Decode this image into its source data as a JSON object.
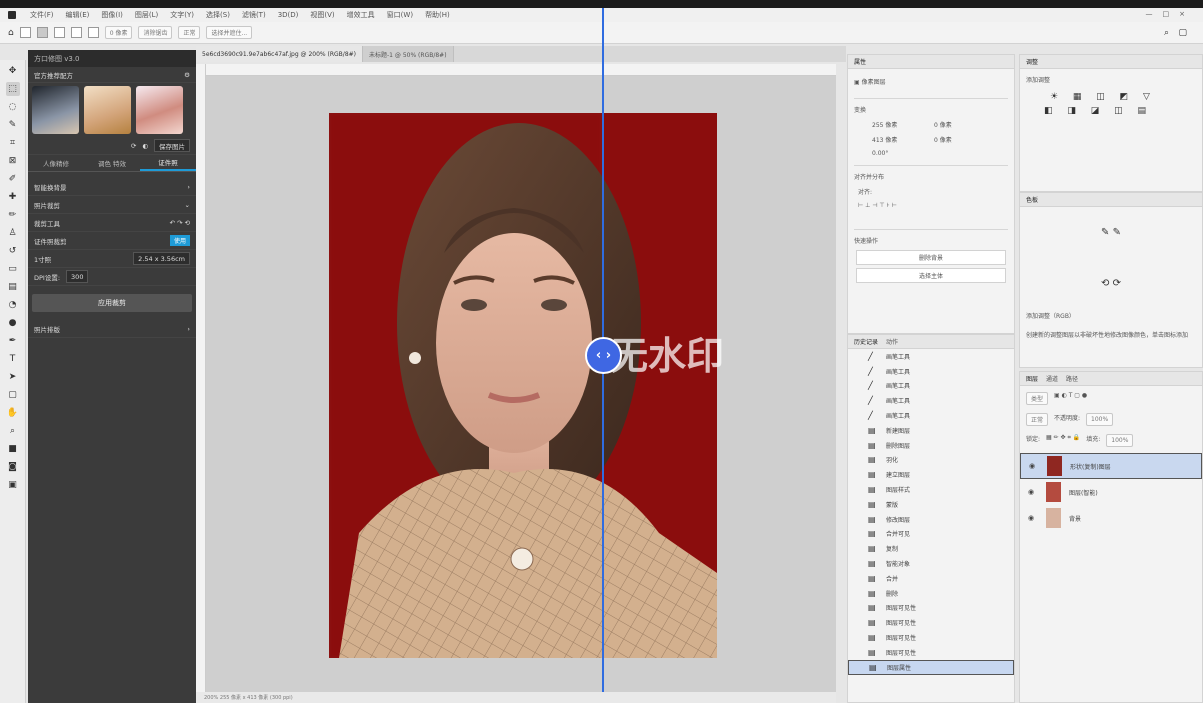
{
  "menubar": {
    "items": [
      "文件(F)",
      "编辑(E)",
      "图像(I)",
      "图层(L)",
      "文字(Y)",
      "选择(S)",
      "滤镜(T)",
      "3D(D)",
      "视图(V)",
      "增效工具",
      "窗口(W)",
      "帮助(H)"
    ],
    "window_controls": [
      "—",
      "□",
      "×"
    ]
  },
  "options": {
    "mode_label": "正常",
    "feather": "0 像素",
    "width_label": "消除锯齿",
    "style": "正常",
    "select_mask": "选择并遮住..."
  },
  "plugin": {
    "title": "方口修图 v3.0",
    "section": "官方推荐配方",
    "btn_save": "保存图片",
    "tabs": [
      "人像精修",
      "调色 特效",
      "证件照"
    ],
    "rows": [
      "智能换背景",
      "照片裁剪"
    ],
    "tool_label": "裁剪工具",
    "id_label": "证件照裁剪",
    "id_tag": "使用",
    "size_label": "1寸照",
    "size_value": "2.54 x 3.56cm",
    "dpi_label": "DPI设置:",
    "dpi_value": "300",
    "apply_btn": "应用裁剪",
    "more": "照片排版"
  },
  "tabs": [
    {
      "label": "5e6cd3690c91.9e7ab6c47af.jpg @ 200% (RGB/8#)",
      "active": true
    },
    {
      "label": "未标题-1 @ 50% (RGB/8#)",
      "active": false
    }
  ],
  "canvas": {
    "watermark": "无水印",
    "status": "200%  255 像素 x 413 像素 (300 ppi)"
  },
  "properties": {
    "title": "属性",
    "layer_label": "像素图层",
    "transform": "变换",
    "w": "255 像素",
    "x": "0 像素",
    "h": "413 像素",
    "y": "0 像素",
    "angle": "0.00°",
    "align": "对齐并分布",
    "align_sub": "对齐:",
    "quick": "快速操作",
    "btn1": "删除背景",
    "btn2": "选择主体"
  },
  "history": {
    "tabs": [
      "历史记录",
      "动作"
    ],
    "items": [
      {
        "icon": "brush",
        "label": "画笔工具"
      },
      {
        "icon": "brush",
        "label": "画笔工具"
      },
      {
        "icon": "brush",
        "label": "画笔工具"
      },
      {
        "icon": "brush",
        "label": "画笔工具"
      },
      {
        "icon": "brush",
        "label": "画笔工具"
      },
      {
        "icon": "doc",
        "label": "新建图层"
      },
      {
        "icon": "doc",
        "label": "删除图层"
      },
      {
        "icon": "doc",
        "label": "羽化"
      },
      {
        "icon": "doc",
        "label": "建立图层"
      },
      {
        "icon": "doc",
        "label": "图层样式"
      },
      {
        "icon": "doc",
        "label": "蒙版"
      },
      {
        "icon": "doc",
        "label": "修改图层"
      },
      {
        "icon": "doc",
        "label": "合并可见"
      },
      {
        "icon": "doc",
        "label": "复制"
      },
      {
        "icon": "doc",
        "label": "智能对象"
      },
      {
        "icon": "doc",
        "label": "合并"
      },
      {
        "icon": "doc",
        "label": "删除"
      },
      {
        "icon": "doc",
        "label": "图层可见性"
      },
      {
        "icon": "doc",
        "label": "图层可见性"
      },
      {
        "icon": "doc",
        "label": "图层可见性"
      },
      {
        "icon": "doc",
        "label": "图层可见性"
      },
      {
        "icon": "doc",
        "label": "图层属性"
      }
    ],
    "selected_index": 21
  },
  "adjustments": {
    "title": "调整",
    "add": "添加调整",
    "panel2": "色板",
    "hint": "添加调整（RGB）",
    "desc": "创建新的调整图层以非破坏性地修改图像颜色，单击图标添加"
  },
  "layers": {
    "tabs": [
      "图层",
      "通道",
      "路径"
    ],
    "kind": "类型",
    "blend": "正常",
    "opacity_label": "不透明度:",
    "opacity": "100%",
    "lock_label": "锁定:",
    "fill_label": "填充:",
    "fill": "100%",
    "items": [
      {
        "name": "形状(复制)图层",
        "selected": true,
        "color": "#8f2721"
      },
      {
        "name": "图层(智能)",
        "selected": false,
        "color": "#b44b3f"
      },
      {
        "name": "背景",
        "selected": false,
        "color": "#d7b3a0"
      }
    ]
  },
  "colors": {
    "accent": "#2f6ce0",
    "photo_bg": "#8b0d0d"
  }
}
